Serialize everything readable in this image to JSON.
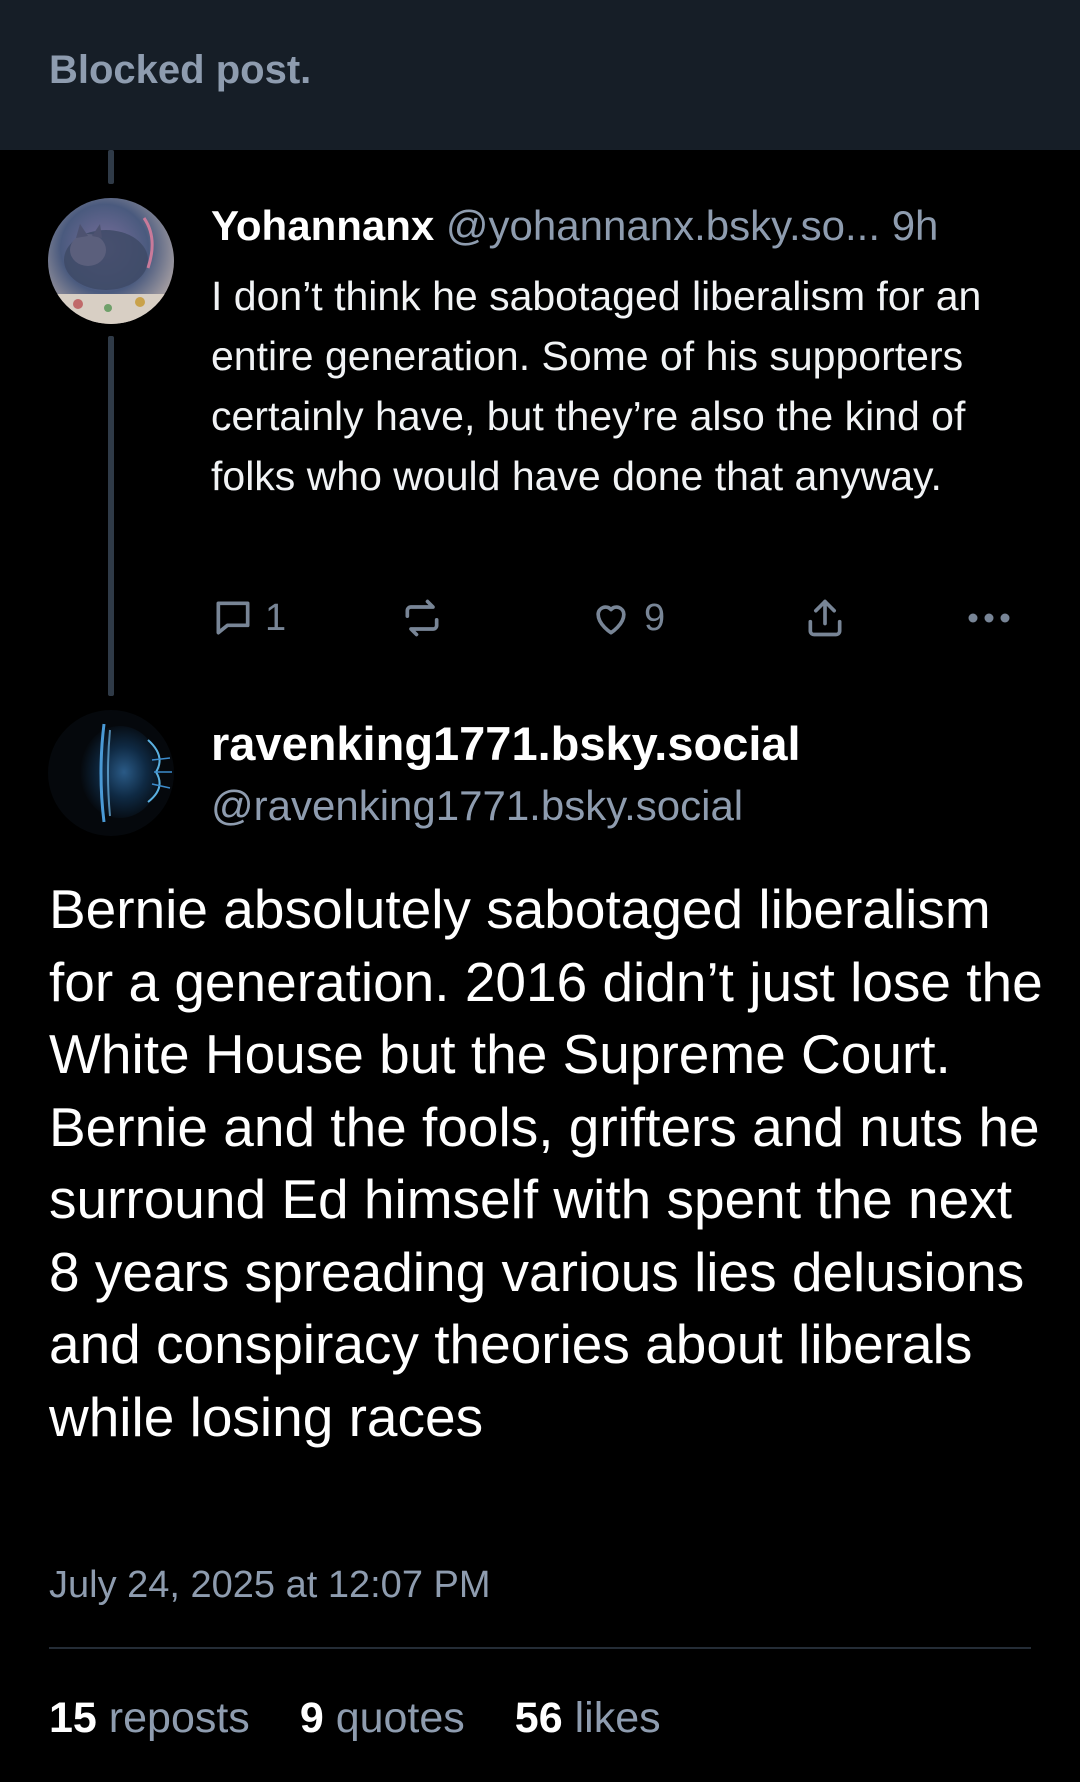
{
  "blocked_post": {
    "label": "Blocked post."
  },
  "reply": {
    "display_name": "Yohannanx",
    "handle": "@yohannanx.bsky.so...",
    "age": "9h",
    "text": "I don’t think he sabotaged liberalism for an entire generation. Some of his supporters certainly have, but they’re also the kind of folks who would have done that anyway.",
    "reply_count": "1",
    "like_count": "9",
    "icons": [
      "reply-icon",
      "repost-icon",
      "like-icon",
      "share-icon",
      "more-icon"
    ]
  },
  "post": {
    "display_name": "ravenking1771.bsky.social",
    "handle": "@ravenking1771.bsky.social",
    "text": "Bernie absolutely sabotaged liberalism for a generation. 2016 didn’t just lose the White House but the Supreme Court. Bernie and the fools, grifters and nuts he surround Ed himself with spent the next 8 years spreading various lies delusions and conspiracy theories about liberals while losing races",
    "timestamp": "July 24, 2025 at 12:07 PM"
  },
  "stats": {
    "reposts_count": "15",
    "reposts_label": "reposts",
    "quotes_count": "9",
    "quotes_label": "quotes",
    "likes_count": "56",
    "likes_label": "likes"
  },
  "colors": {
    "background": "#000000",
    "header_bar": "#161e27",
    "muted_text": "#8e9caf",
    "thread_line": "#2f3a47"
  }
}
